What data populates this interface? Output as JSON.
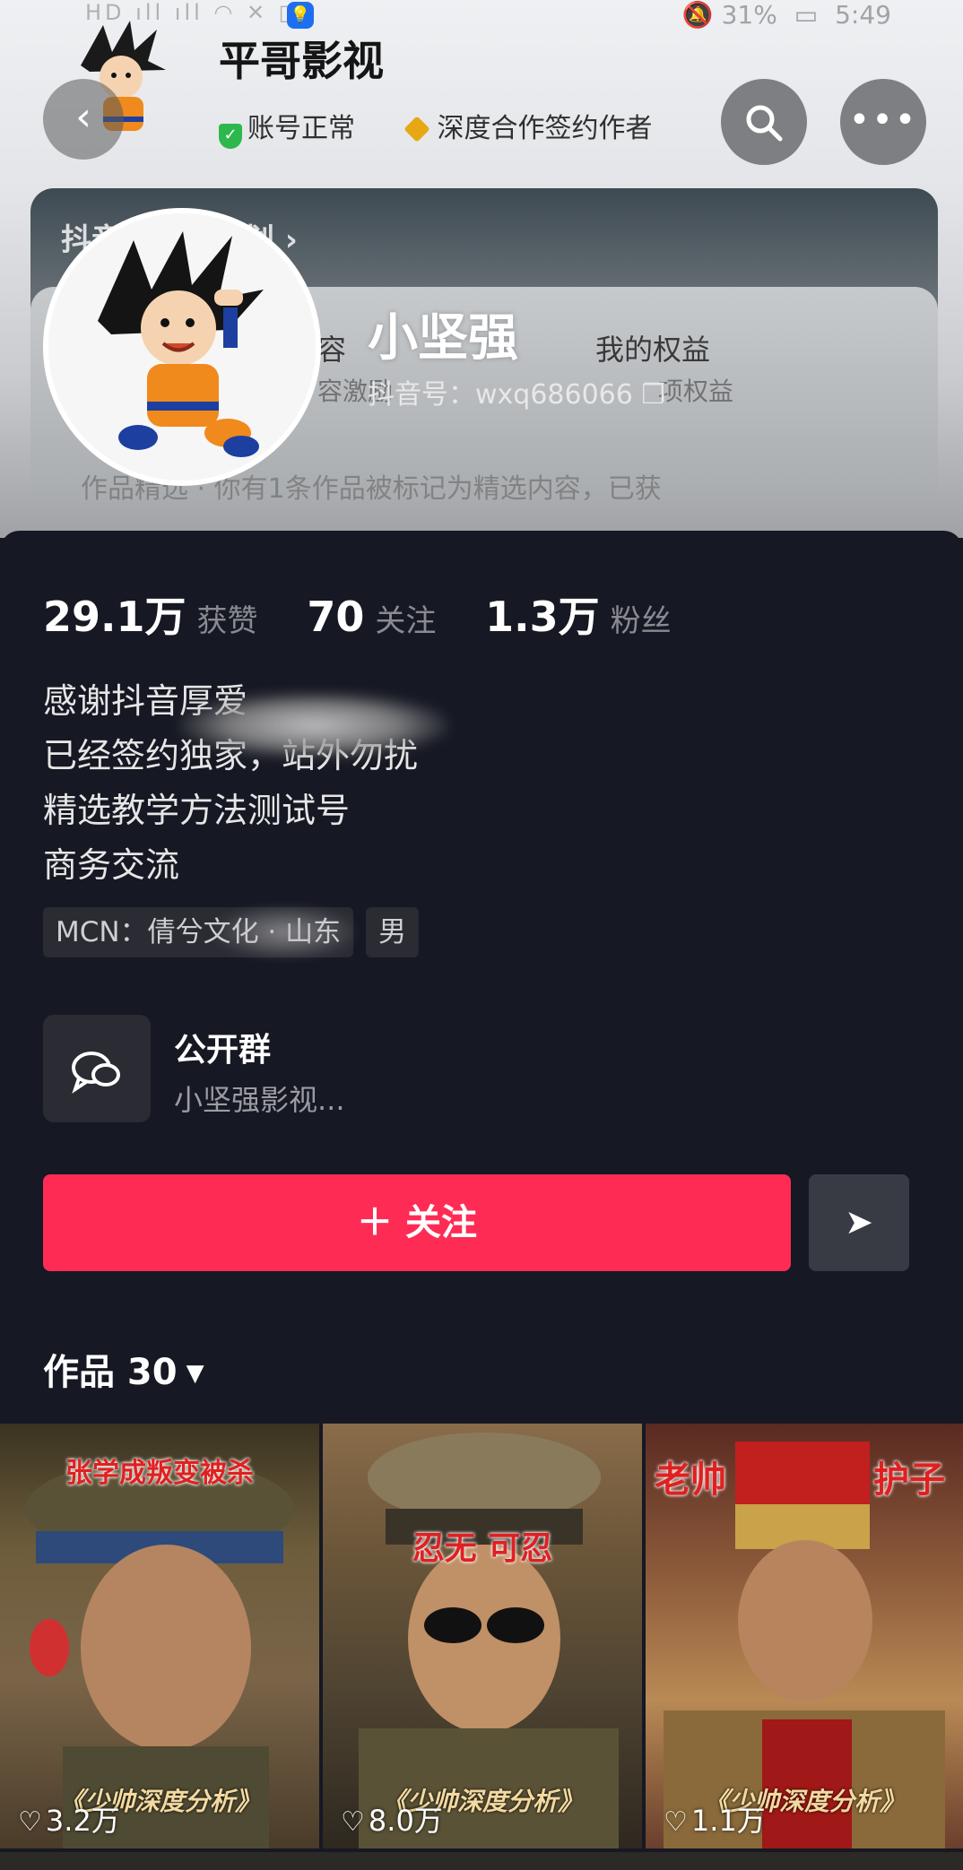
{
  "status_bar": {
    "left": "HD ıll ıll ◠ ✕ ▯",
    "notification": "💡",
    "battery": "🔕 31%",
    "time": "5:49"
  },
  "header": {
    "back_icon": "‹",
    "title": "平哥影视",
    "badge_account": "账号正常",
    "badge_author": "深度合作签约作者",
    "search_icon": "search-icon",
    "more_icon": "•••"
  },
  "promo": {
    "title": "抖音创作者计划 ›",
    "item1": "容",
    "item2": "我的权益",
    "item1_sub": "容激励",
    "item2_sub": "项权益",
    "line": "作品精选 · 你有1条作品被标记为精选内容，已获"
  },
  "profile": {
    "nickname": "小坚强",
    "douyin_id": "抖音号：wxq686066 ❐"
  },
  "stats": [
    {
      "num": "29.1万",
      "label": "获赞"
    },
    {
      "num": "70",
      "label": "关注"
    },
    {
      "num": "1.3万",
      "label": "粉丝"
    }
  ],
  "bio": {
    "line1": "感谢抖音厚爱",
    "line2": "已经签约独家，站外勿扰",
    "line3": "精选教学方法测试号",
    "line4": "商务交流"
  },
  "tags": {
    "mcn": "MCN：倩兮文化 · 山东",
    "gender": "男"
  },
  "group": {
    "title": "公开群",
    "subtitle": "小坚强影视..."
  },
  "actions": {
    "follow": "＋ 关注",
    "share_icon": "➤"
  },
  "works": {
    "label": "作品 30",
    "caret": "▼"
  },
  "tiles": [
    {
      "caption": "张学成叛变被杀",
      "sub": "《少帅深度分析》",
      "likes": "3.2万"
    },
    {
      "caption": "忍无 可忍",
      "sub": "《少帅深度分析》",
      "likes": "8.0万"
    },
    {
      "caption_left": "老帅",
      "caption_right": "护子",
      "sub": "《少帅深度分析》",
      "likes": "1.1万"
    }
  ]
}
